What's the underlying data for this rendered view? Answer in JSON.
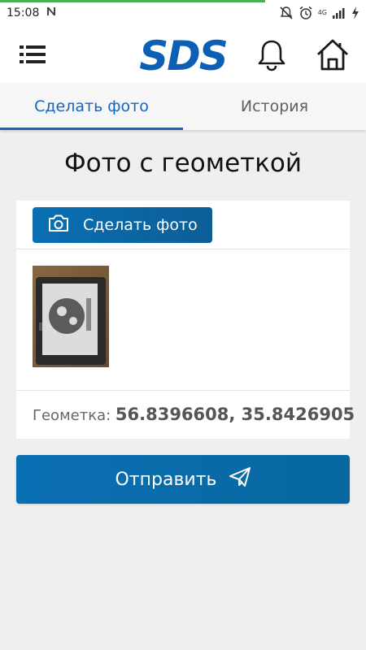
{
  "status_bar": {
    "time": "15:08",
    "network_label": "4G",
    "icons": [
      "notification-n-icon",
      "mute-icon",
      "alarm-icon",
      "signal-icon",
      "charging-icon"
    ]
  },
  "header": {
    "logo_text": "SDS",
    "icons": [
      "menu-icon",
      "bell-icon",
      "home-icon"
    ],
    "brand_color": "#0d5fb5"
  },
  "tabs": [
    {
      "label": "Сделать фото",
      "active": true
    },
    {
      "label": "История",
      "active": false
    }
  ],
  "main": {
    "title": "Фото с геометкой",
    "photo_button_label": "Сделать фото",
    "geotag_label": "Геометка:",
    "geotag_value": "56.8396608, 35.8426905",
    "send_button_label": "Отправить"
  },
  "colors": {
    "accent": "#1565c0",
    "button": "#0a6fb3",
    "background": "#efefef"
  }
}
